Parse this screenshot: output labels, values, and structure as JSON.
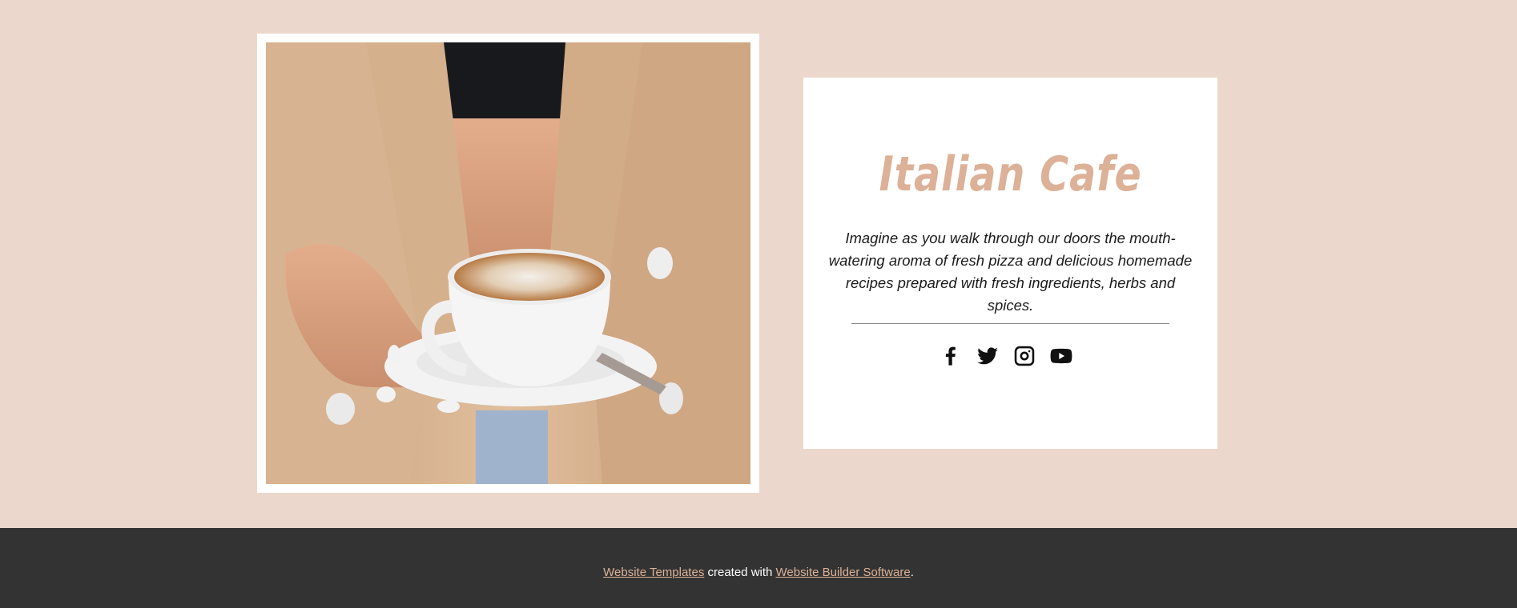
{
  "hero": {
    "image_alt": "Woman in beige blazer holding a cappuccino cup on a saucer"
  },
  "card": {
    "title": "Italian Cafe",
    "description": "Imagine as you walk through our doors the mouth-watering aroma of fresh pizza and delicious homemade recipes prepared with fresh ingredients, herbs and spices.",
    "socials": [
      {
        "icon": "facebook-icon"
      },
      {
        "icon": "twitter-icon"
      },
      {
        "icon": "instagram-icon"
      },
      {
        "icon": "youtube-icon"
      }
    ]
  },
  "footer": {
    "link1": "Website Templates",
    "middle": " created with ",
    "link2": "Website Builder Software",
    "end": "."
  },
  "colors": {
    "background": "#ebd7cb",
    "accent": "#dcb197",
    "footer_bg": "#333333"
  }
}
